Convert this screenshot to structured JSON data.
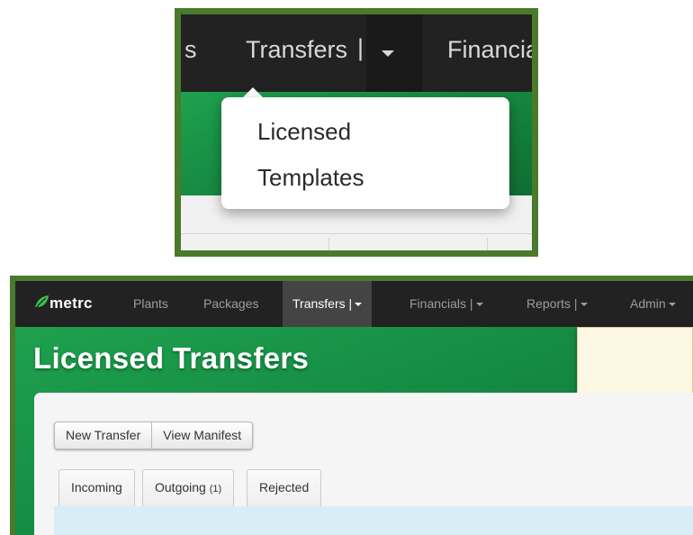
{
  "zoom": {
    "nav": {
      "left_fragment": "s",
      "transfers": "Transfers",
      "separator": "|",
      "right_fragment": "Financia"
    },
    "dropdown_items": [
      "Licensed",
      "Templates"
    ]
  },
  "nav": {
    "logo": "metrc",
    "items": [
      "Plants",
      "Packages",
      "Transfers",
      "Financials",
      "Reports",
      "Admin"
    ],
    "separator": "|"
  },
  "page": {
    "title": "Licensed Transfers",
    "buttons": [
      "New Transfer",
      "View Manifest"
    ],
    "tabs": [
      {
        "label": "Incoming",
        "count": ""
      },
      {
        "label": "Outgoing",
        "count": "(1)"
      },
      {
        "label": "Rejected",
        "count": ""
      }
    ]
  },
  "colors": {
    "frame_green": "#4a7a2c",
    "navbar": "#222222",
    "hero_green": "#1ea14f",
    "notice": "#fcf8e3",
    "content_blue": "#d9edf7"
  },
  "icons": [
    "metrc-leaf-icon",
    "caret-down-icon"
  ]
}
